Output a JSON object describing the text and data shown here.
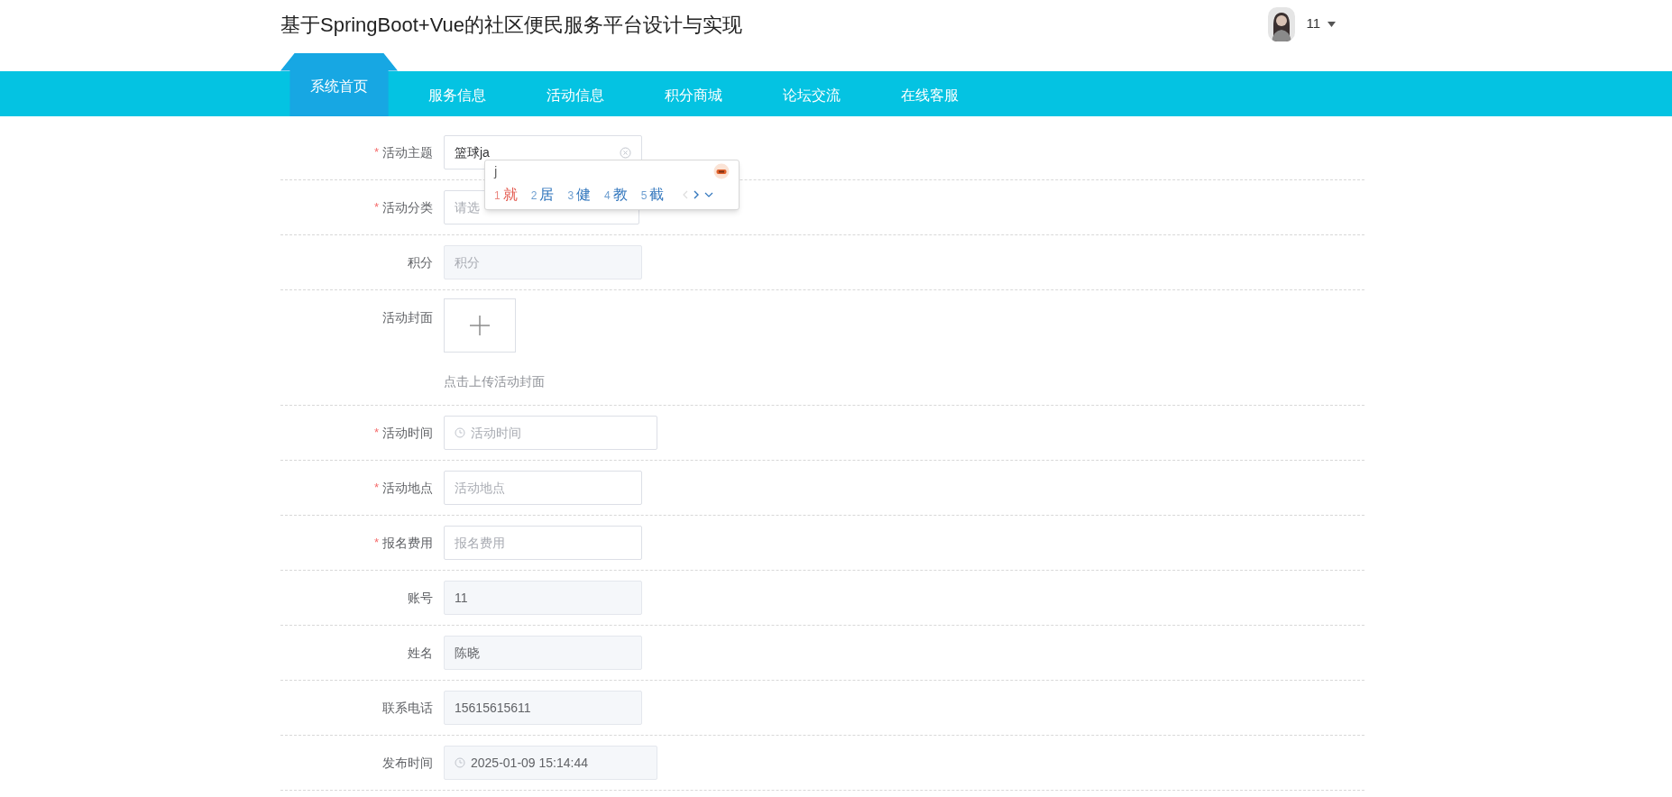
{
  "header": {
    "title": "基于SpringBoot+Vue的社区便民服务平台设计与实现",
    "user": {
      "name": "11"
    }
  },
  "nav": [
    {
      "label": "系统首页",
      "selected": true
    },
    {
      "label": "服务信息",
      "selected": false
    },
    {
      "label": "活动信息",
      "selected": false
    },
    {
      "label": "积分商城",
      "selected": false
    },
    {
      "label": "论坛交流",
      "selected": false
    },
    {
      "label": "在线客服",
      "selected": false
    }
  ],
  "form": {
    "fields": [
      {
        "label": "活动主题",
        "required_mark": "*",
        "kind": "input_focused",
        "value": "篮球ja"
      },
      {
        "label": "活动分类",
        "required_mark": "*",
        "kind": "select",
        "placeholder": "请选"
      },
      {
        "label": "积分",
        "kind": "input_disabled",
        "placeholder": "积分"
      },
      {
        "label": "活动封面",
        "kind": "upload",
        "hint": "点击上传活动封面"
      },
      {
        "label": "活动时间",
        "required_mark": "*",
        "kind": "date",
        "placeholder": "活动时间"
      },
      {
        "label": "活动地点",
        "required_mark": "*",
        "kind": "input",
        "placeholder": "活动地点"
      },
      {
        "label": "报名费用",
        "required_mark": "*",
        "kind": "input",
        "placeholder": "报名费用"
      },
      {
        "label": "账号",
        "kind": "input_disabled",
        "value": "11"
      },
      {
        "label": "姓名",
        "kind": "input_disabled",
        "value": "陈晓"
      },
      {
        "label": "联系电话",
        "kind": "input_disabled",
        "value": "15615615611"
      },
      {
        "label": "发布时间",
        "kind": "date_disabled",
        "value": "2025-01-09 15:14:44"
      }
    ]
  },
  "ime": {
    "composition": "j",
    "candidates": [
      {
        "number": "1",
        "text": "就",
        "selected": true
      },
      {
        "number": "2",
        "text": "居",
        "selected": false
      },
      {
        "number": "3",
        "text": "健",
        "selected": false
      },
      {
        "number": "4",
        "text": "教",
        "selected": false
      },
      {
        "number": "5",
        "text": "截",
        "selected": false
      }
    ]
  }
}
